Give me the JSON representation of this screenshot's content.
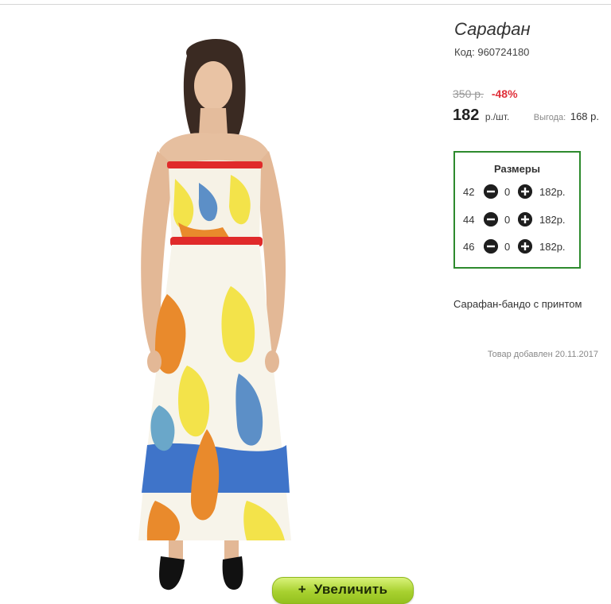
{
  "product": {
    "title": "Сарафан",
    "sku_label": "Код:",
    "sku": "960724180",
    "old_price": "350 р.",
    "discount": "-48%",
    "price": "182",
    "price_unit": "р./шт.",
    "savings_label": "Выгода:",
    "savings_value": "168 р.",
    "description": "Сарафан-бандо с принтом",
    "added": "Товар добавлен 20.11.2017"
  },
  "sizes": {
    "title": "Размеры",
    "rows": [
      {
        "size": "42",
        "qty": "0",
        "price": "182р."
      },
      {
        "size": "44",
        "qty": "0",
        "price": "182р."
      },
      {
        "size": "46",
        "qty": "0",
        "price": "182р."
      }
    ]
  },
  "zoom": {
    "icon": "plus-icon",
    "label": "Увеличить"
  },
  "colors": {
    "accent_green": "#2d8a2d",
    "discount_red": "#e0303a",
    "button_green": "#a8d12f"
  }
}
